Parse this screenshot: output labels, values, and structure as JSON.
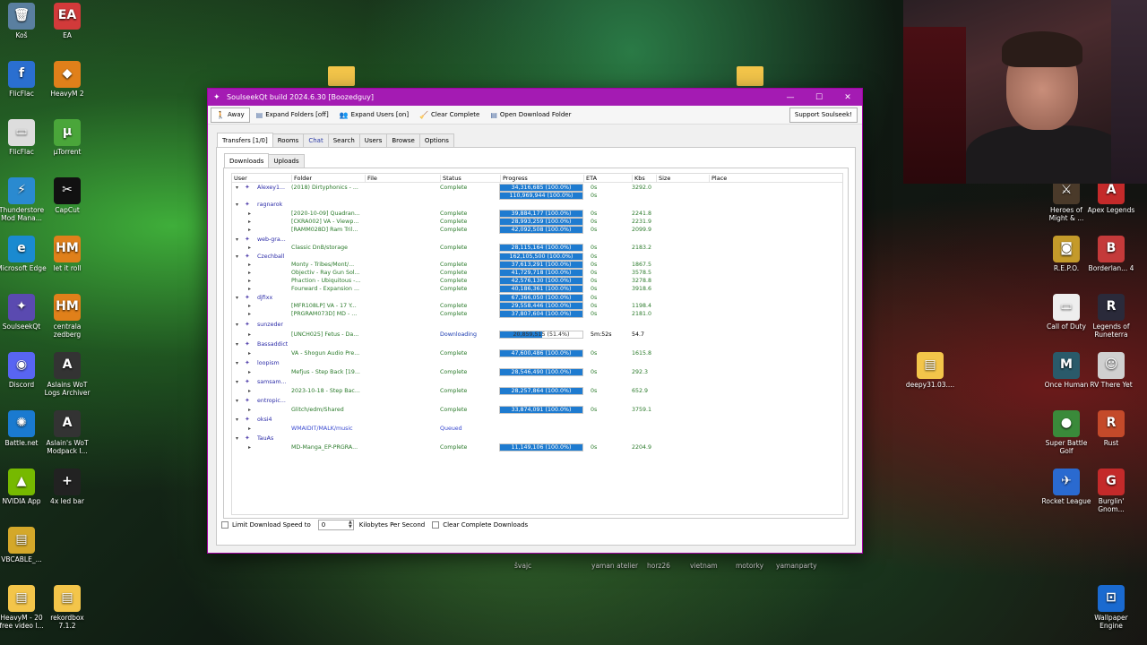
{
  "desktop": {
    "left_icons": [
      {
        "label": "Koš",
        "glyph": "🗑",
        "color": "#5a7fa0"
      },
      {
        "label": "EA",
        "glyph": "EA",
        "color": "#d23a3a"
      },
      {
        "label": "FlicFlac",
        "glyph": "f",
        "color": "#2a6fd0"
      },
      {
        "label": "HeavyM 2",
        "glyph": "◆",
        "color": "#e0801a"
      },
      {
        "label": "FlicFlac",
        "glyph": "▭",
        "color": "#dddddd"
      },
      {
        "label": "µTorrent",
        "glyph": "µ",
        "color": "#4aa63a"
      },
      {
        "label": "Thunderstore Mod Mana...",
        "glyph": "⚡",
        "color": "#2a8ad0"
      },
      {
        "label": "CapCut",
        "glyph": "✂",
        "color": "#111111"
      },
      {
        "label": "Microsoft Edge",
        "glyph": "e",
        "color": "#1a8ad0"
      },
      {
        "label": "let it roll",
        "glyph": "HM",
        "color": "#e0801a"
      },
      {
        "label": "SoulseekQt",
        "glyph": "✦",
        "color": "#5a4ab0"
      },
      {
        "label": "centrala zedberg",
        "glyph": "HM",
        "color": "#e0801a"
      },
      {
        "label": "Discord",
        "glyph": "◉",
        "color": "#5865f2"
      },
      {
        "label": "Aslains WoT Logs Archiver",
        "glyph": "A",
        "color": "#333333"
      },
      {
        "label": "Battle.net",
        "glyph": "✺",
        "color": "#1a7ad0"
      },
      {
        "label": "Aslain's WoT Modpack I...",
        "glyph": "A",
        "color": "#333333"
      },
      {
        "label": "NVIDIA App",
        "glyph": "▲",
        "color": "#76b900"
      },
      {
        "label": "4x led bar",
        "glyph": "+",
        "color": "#222222"
      },
      {
        "label": "VBCABLE_...",
        "glyph": "▤",
        "color": "#d4a82a"
      },
      {
        "label": "HeavyM - 20 free video l...",
        "glyph": "▤",
        "color": "#f3c54a"
      },
      {
        "label": "rekordbox 7.1.2",
        "glyph": "▤",
        "color": "#f3c54a"
      }
    ],
    "right_icons": [
      {
        "label": "Heroes of Might & ...",
        "glyph": "⚔",
        "color": "#4a3a2a"
      },
      {
        "label": "Apex Legends",
        "glyph": "A",
        "color": "#c42a2a"
      },
      {
        "label": "R.E.P.O.",
        "glyph": "◙",
        "color": "#c49a2a"
      },
      {
        "label": "Borderlan... 4",
        "glyph": "B",
        "color": "#c43a3a"
      },
      {
        "label": "Call of Duty",
        "glyph": "▭",
        "color": "#eeeeee"
      },
      {
        "label": "Legends of Runeterra",
        "glyph": "R",
        "color": "#2a2a3a"
      },
      {
        "label": "deepy31.03....",
        "glyph": "▤",
        "color": "#f3c54a"
      },
      {
        "label": "Once Human",
        "glyph": "M",
        "color": "#2a5a6a"
      },
      {
        "label": "RV There Yet",
        "glyph": "☺",
        "color": "#d0d0d0"
      },
      {
        "label": "Super Battle Golf",
        "glyph": "●",
        "color": "#3a8a3a"
      },
      {
        "label": "Rust",
        "glyph": "R",
        "color": "#c44a2a"
      },
      {
        "label": "Rocket League",
        "glyph": "✈",
        "color": "#2a6ad0"
      },
      {
        "label": "Burglin' Gnom...",
        "glyph": "G",
        "color": "#c42a2a"
      },
      {
        "label": "Wallpaper Engine",
        "glyph": "⊡",
        "color": "#1a6ad0"
      }
    ],
    "bottom_labels": [
      "švajc",
      "yaman atelier",
      "horz26",
      "vietnam",
      "motorky",
      "yamanparty"
    ]
  },
  "window": {
    "title": "SoulseekQt build 2024.6.30 [Boozedguy]",
    "controls": {
      "minimize": "—",
      "maximize": "☐",
      "close": "✕"
    },
    "toolbar": {
      "away": "Away",
      "expand_folders": "Expand Folders [off]",
      "expand_users": "Expand Users [on]",
      "clear_complete": "Clear Complete",
      "open_download_folder": "Open Download Folder",
      "support": "Support Soulseek!"
    },
    "tabs": [
      "Transfers [1/0]",
      "Rooms",
      "Chat",
      "Search",
      "Users",
      "Browse",
      "Options"
    ],
    "subtabs": [
      "Downloads",
      "Uploads"
    ],
    "columns": [
      "User",
      "Folder",
      "File",
      "Status",
      "Progress",
      "ETA",
      "Kbs",
      "Size",
      "Place"
    ],
    "accent": "#1e7bd0",
    "titlebar_color": "#a41bb3",
    "rows": [
      {
        "user": "Alexey1...",
        "folder": "(2018) Dirtyphonics - ...",
        "status": "Complete",
        "progress": "34,316,685 (100.0%)",
        "pct": 100,
        "eta": "0s",
        "kbs": "3292.0"
      },
      {
        "user": "",
        "folder": "",
        "status": "",
        "progress": "110,969,944 (100.0%)",
        "pct": 100,
        "eta": "0s",
        "kbs": ""
      },
      {
        "user": "ragnarok",
        "folder": "",
        "status": "",
        "progress": "",
        "pct": 0,
        "eta": "",
        "kbs": ""
      },
      {
        "user": "",
        "folder": "[2020-10-09] Quadran...",
        "status": "Complete",
        "progress": "39,884,177 (100.0%)",
        "pct": 100,
        "eta": "0s",
        "kbs": "2241.8"
      },
      {
        "user": "",
        "folder": "[CKRA002] VA - Viewp...",
        "status": "Complete",
        "progress": "28,993,259 (100.0%)",
        "pct": 100,
        "eta": "0s",
        "kbs": "2231.9"
      },
      {
        "user": "",
        "folder": "[RAMM028D] Ram Tril...",
        "status": "Complete",
        "progress": "42,092,508 (100.0%)",
        "pct": 100,
        "eta": "0s",
        "kbs": "2099.9"
      },
      {
        "user": "web-gra...",
        "folder": "",
        "status": "",
        "progress": "",
        "pct": 0,
        "eta": "",
        "kbs": ""
      },
      {
        "user": "",
        "folder": "Classic DnB/storage",
        "status": "Complete",
        "progress": "28,115,164 (100.0%)",
        "pct": 100,
        "eta": "0s",
        "kbs": "2183.2"
      },
      {
        "user": "Czechball",
        "folder": "",
        "status": "",
        "progress": "162,105,500 (100.0%)",
        "pct": 100,
        "eta": "0s",
        "kbs": ""
      },
      {
        "user": "",
        "folder": "Monty - Tribes/Mont/...",
        "status": "Complete",
        "progress": "37,613,291 (100.0%)",
        "pct": 100,
        "eta": "0s",
        "kbs": "1867.5"
      },
      {
        "user": "",
        "folder": "Objectiv - Ray Gun Sol...",
        "status": "Complete",
        "progress": "41,729,718 (100.0%)",
        "pct": 100,
        "eta": "0s",
        "kbs": "3578.5"
      },
      {
        "user": "",
        "folder": "Phaction - Ubiquitous -...",
        "status": "Complete",
        "progress": "42,576,130 (100.0%)",
        "pct": 100,
        "eta": "0s",
        "kbs": "3278.8"
      },
      {
        "user": "",
        "folder": "Fourward - Expansion ...",
        "status": "Complete",
        "progress": "40,186,361 (100.0%)",
        "pct": 100,
        "eta": "0s",
        "kbs": "3918.6"
      },
      {
        "user": "djfixx",
        "folder": "",
        "status": "",
        "progress": "67,366,050 (100.0%)",
        "pct": 100,
        "eta": "0s",
        "kbs": ""
      },
      {
        "user": "",
        "folder": "[MFR108LP] VA - 17 Y...",
        "status": "Complete",
        "progress": "29,558,446 (100.0%)",
        "pct": 100,
        "eta": "0s",
        "kbs": "1198.4"
      },
      {
        "user": "",
        "folder": "[PRGRAM073D] MD - ...",
        "status": "Complete",
        "progress": "37,807,604 (100.0%)",
        "pct": 100,
        "eta": "0s",
        "kbs": "2181.0"
      },
      {
        "user": "sunzeder",
        "folder": "",
        "status": "",
        "progress": "",
        "pct": 0,
        "eta": "",
        "kbs": ""
      },
      {
        "user": "",
        "folder": "[UNCH025] Fetus - Da...",
        "status": "Downloading",
        "progress": "20,859,515 (51.4%)",
        "pct": 51.4,
        "eta": "5m:52s",
        "kbs": "54.7"
      },
      {
        "user": "Bassaddict",
        "folder": "",
        "status": "",
        "progress": "",
        "pct": 0,
        "eta": "",
        "kbs": ""
      },
      {
        "user": "",
        "folder": "VA - Shogun Audio Pre...",
        "status": "Complete",
        "progress": "47,600,486 (100.0%)",
        "pct": 100,
        "eta": "0s",
        "kbs": "1615.8"
      },
      {
        "user": "loopism",
        "folder": "",
        "status": "",
        "progress": "",
        "pct": 0,
        "eta": "",
        "kbs": ""
      },
      {
        "user": "",
        "folder": "Mefjus - Step Back [19...",
        "status": "Complete",
        "progress": "28,546,490 (100.0%)",
        "pct": 100,
        "eta": "0s",
        "kbs": "292.3"
      },
      {
        "user": "samsam...",
        "folder": "",
        "status": "",
        "progress": "",
        "pct": 0,
        "eta": "",
        "kbs": ""
      },
      {
        "user": "",
        "folder": "2023-10-18 - Step Bac...",
        "status": "Complete",
        "progress": "28,257,864 (100.0%)",
        "pct": 100,
        "eta": "0s",
        "kbs": "652.9"
      },
      {
        "user": "entropic...",
        "folder": "",
        "status": "",
        "progress": "",
        "pct": 0,
        "eta": "",
        "kbs": ""
      },
      {
        "user": "",
        "folder": "Glitch/edm/Shared",
        "status": "Complete",
        "progress": "33,874,091 (100.0%)",
        "pct": 100,
        "eta": "0s",
        "kbs": "3759.1"
      },
      {
        "user": "oksi4",
        "folder": "",
        "status": "",
        "progress": "",
        "pct": 0,
        "eta": "",
        "kbs": ""
      },
      {
        "user": "",
        "folder": "WMAIDIT/MALK/music",
        "status": "Queued",
        "progress": "",
        "pct": 0,
        "eta": "",
        "kbs": ""
      },
      {
        "user": "TauAs",
        "folder": "",
        "status": "",
        "progress": "",
        "pct": 0,
        "eta": "",
        "kbs": ""
      },
      {
        "user": "",
        "folder": "MD-Manga_EP-PRGRA...",
        "status": "Complete",
        "progress": "11,149,106 (100.0%)",
        "pct": 100,
        "eta": "0s",
        "kbs": "2204.9"
      }
    ],
    "bottom": {
      "limit_label": "Limit Download Speed to",
      "limit_value": "0",
      "unit_label": "Kilobytes Per Second",
      "clear_label": "Clear Complete Downloads"
    }
  }
}
